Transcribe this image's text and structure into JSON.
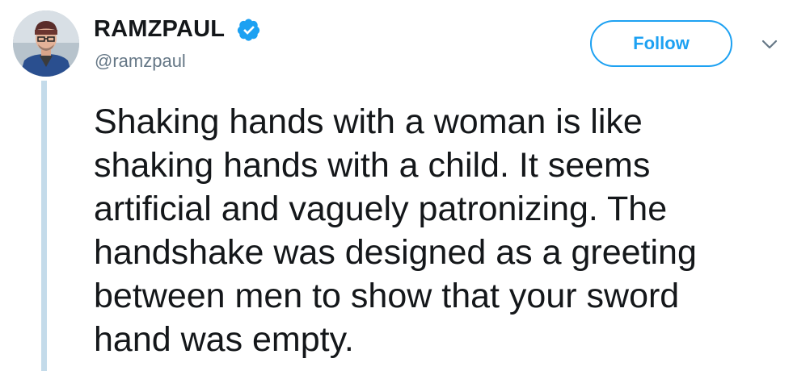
{
  "tweet": {
    "author": {
      "display_name": "RAMZPAUL",
      "handle": "@ramzpaul",
      "verified": true
    },
    "follow_label": "Follow",
    "text_lines": [
      "Shaking hands with a woman is like",
      "shaking hands with a child. It seems",
      "artificial and vaguely patronizing. The",
      "handshake was designed as a greeting",
      "between men to show that your sword",
      "hand was empty."
    ]
  },
  "icons": {
    "verified": "verified-badge-icon",
    "menu": "chevron-down-icon"
  },
  "colors": {
    "accent": "#1da1f2",
    "text": "#14171a",
    "secondary_text": "#657786",
    "thread_line": "#c4dbea"
  }
}
